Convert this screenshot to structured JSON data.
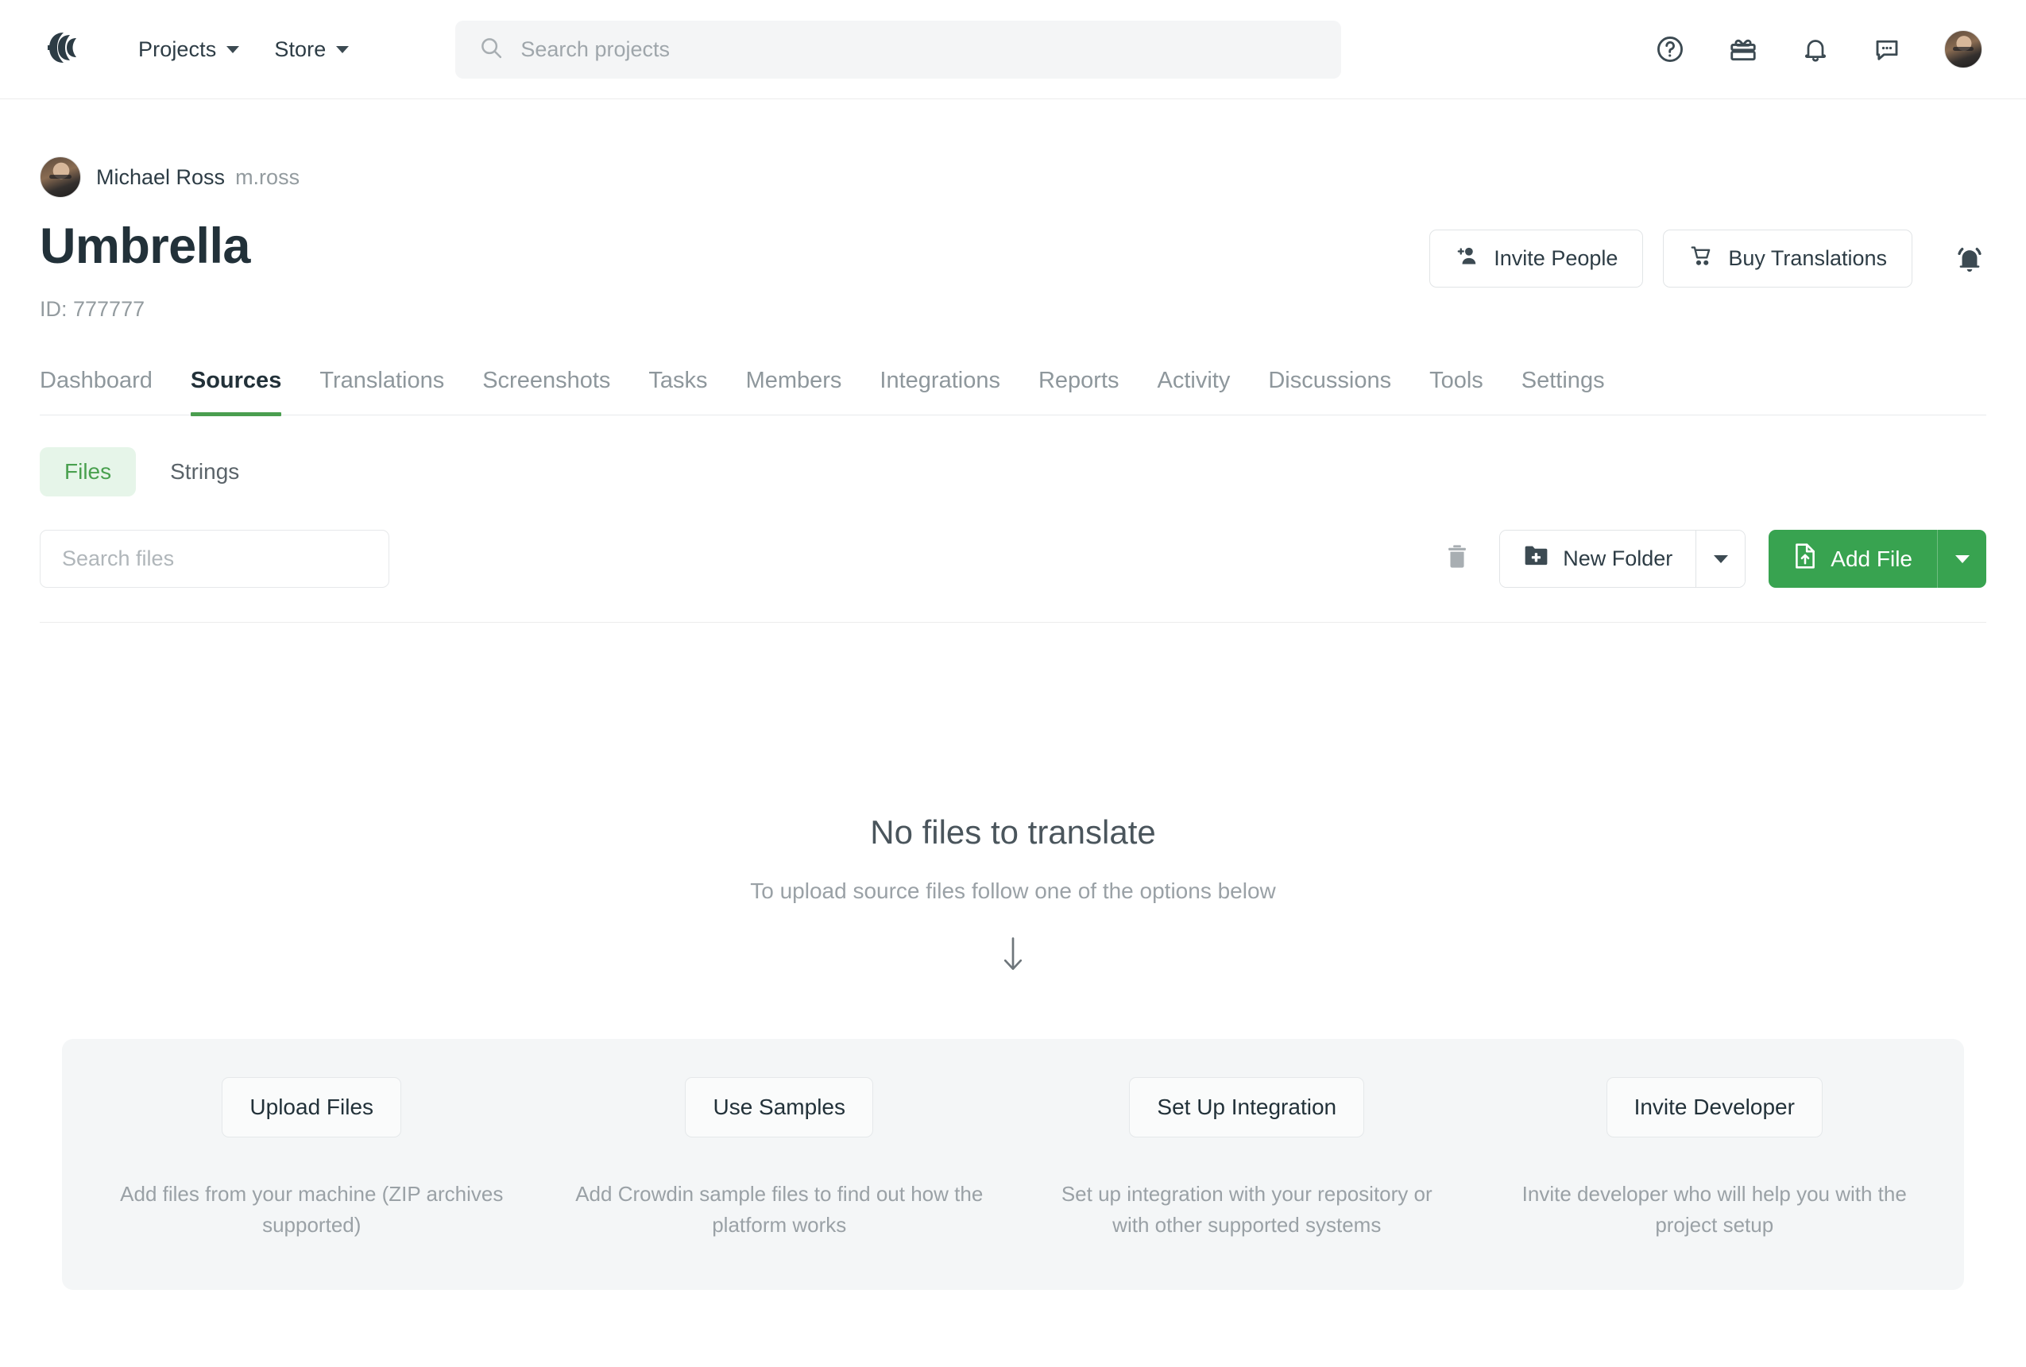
{
  "topnav": {
    "logo_icon": "crowdin-logo-icon",
    "links": [
      {
        "label": "Projects",
        "icon": "chevron-down-icon"
      },
      {
        "label": "Store",
        "icon": "chevron-down-icon"
      }
    ],
    "search": {
      "placeholder": "Search projects",
      "value": "",
      "icon": "search-icon"
    },
    "icons": [
      {
        "name": "help-icon"
      },
      {
        "name": "gift-icon"
      },
      {
        "name": "bell-icon"
      },
      {
        "name": "chat-icon"
      },
      {
        "name": "avatar"
      }
    ]
  },
  "project": {
    "owner_name": "Michael Ross",
    "owner_handle": "m.ross",
    "title": "Umbrella",
    "id_label": "ID: 777777",
    "actions": {
      "invite_people": "Invite People",
      "buy_translations": "Buy Translations",
      "subscribe_icon": "bell-filled-icon"
    }
  },
  "tabs": [
    {
      "label": "Dashboard",
      "active": false
    },
    {
      "label": "Sources",
      "active": true
    },
    {
      "label": "Translations",
      "active": false
    },
    {
      "label": "Screenshots",
      "active": false
    },
    {
      "label": "Tasks",
      "active": false
    },
    {
      "label": "Members",
      "active": false
    },
    {
      "label": "Integrations",
      "active": false
    },
    {
      "label": "Reports",
      "active": false
    },
    {
      "label": "Activity",
      "active": false
    },
    {
      "label": "Discussions",
      "active": false
    },
    {
      "label": "Tools",
      "active": false
    },
    {
      "label": "Settings",
      "active": false
    }
  ],
  "subtabs": [
    {
      "label": "Files",
      "active": true
    },
    {
      "label": "Strings",
      "active": false
    }
  ],
  "toolbar": {
    "search_files_placeholder": "Search files",
    "search_files_value": "",
    "delete_icon": "trash-icon",
    "new_folder_label": "New Folder",
    "new_folder_icon": "folder-plus-icon",
    "add_file_label": "Add File",
    "add_file_icon": "file-upload-icon",
    "dropdown_icon": "chevron-down-icon"
  },
  "empty_state": {
    "title": "No files to translate",
    "subtitle": "To upload source files follow one of the options below",
    "arrow_icon": "arrow-down-icon"
  },
  "options": [
    {
      "button": "Upload Files",
      "description": "Add files from your machine (ZIP archives supported)"
    },
    {
      "button": "Use Samples",
      "description": "Add Crowdin sample files to find out how the platform works"
    },
    {
      "button": "Set Up Integration",
      "description": "Set up integration with your repository or with other supported systems"
    },
    {
      "button": "Invite Developer",
      "description": "Invite developer who will help you with the project setup"
    }
  ],
  "colors": {
    "brand_green": "#38a350",
    "tab_underline": "#4a9e4f",
    "pill_active_bg": "#e6f5e9",
    "pill_active_text": "#49a04f",
    "panel_bg": "#f4f6f7",
    "text_primary": "#223139",
    "text_muted": "#9aa1a6"
  }
}
